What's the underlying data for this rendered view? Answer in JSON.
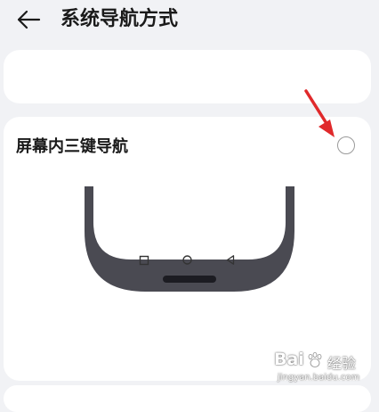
{
  "header": {
    "back_icon": "arrow-left-icon",
    "title": "系统导航方式"
  },
  "option": {
    "label": "屏幕内三键导航",
    "selected": false
  },
  "nav_buttons": {
    "recent_icon": "square-icon",
    "home_icon": "circle-icon",
    "back_icon": "triangle-back-icon"
  },
  "annotation": {
    "arrow_color": "#e0292b"
  },
  "watermark": {
    "brand": "Bai",
    "brand_tail": "经验",
    "sub": "jingyan.baidu.com"
  },
  "colors": {
    "background": "#f1f2f5",
    "card": "#ffffff",
    "phone_frame": "#4a4a52",
    "text": "#1a1a1a"
  }
}
